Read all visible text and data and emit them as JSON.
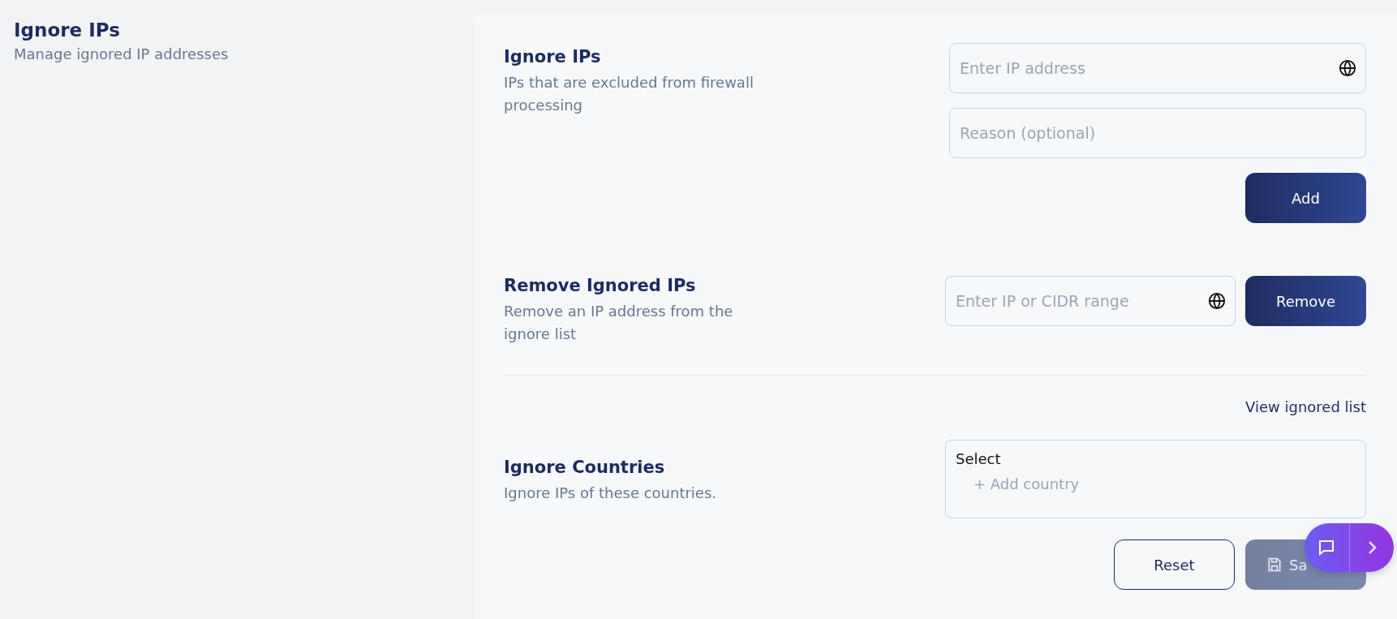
{
  "header": {
    "title": "Ignore IPs",
    "subtitle": "Manage ignored IP addresses"
  },
  "sections": [
    {
      "kind": "add",
      "title": "Ignore IPs",
      "description": "IPs that are excluded from firewall processing",
      "fields": [
        {
          "placeholder": "Enter IP address",
          "icon": true
        },
        {
          "placeholder": "Reason (optional)",
          "icon": false
        }
      ],
      "button": "Add"
    },
    {
      "kind": "remove",
      "title": "Remove Ignored IPs",
      "description": "Remove an IP address from the ignore list",
      "fields": [
        {
          "placeholder": "Enter IP or CIDR range",
          "icon": true
        }
      ],
      "button": "Remove"
    }
  ],
  "view_link": "View ignored list",
  "countries": {
    "title": "Ignore Countries",
    "description": "Ignore IPs of these countries.",
    "select_label": "Select",
    "add_label": "+ Add country"
  },
  "actions": [
    {
      "kind": "reset",
      "label": "Reset",
      "disabled": false
    },
    {
      "kind": "save",
      "label": "Sa",
      "disabled": true
    }
  ]
}
